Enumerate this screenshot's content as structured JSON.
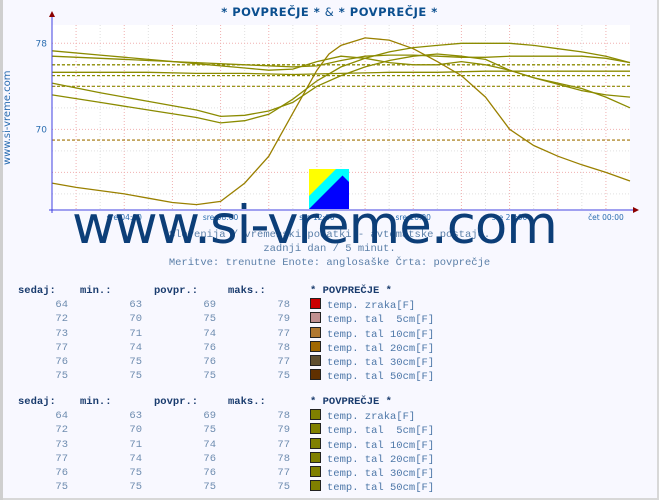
{
  "title": {
    "left": "* POVPREČJE *",
    "amp": "&",
    "right": "* POVPREČJE *"
  },
  "side_label": "www.si-vreme.com",
  "watermark": "www.si-vreme.com",
  "subtitle_lines": [
    "Slovenija / vremenski podatki - avtomatske postaje.",
    "zadnji dan / 5 minut.",
    "Meritve: trenutne  Enote: anglosaške  Črta: povprečje"
  ],
  "colors": {
    "line": "#8b8b00",
    "axis": "#4040e0",
    "grid": "#e8a0a0",
    "arrow": "#8b0000",
    "title": "#0b4f8f"
  },
  "chart_data": {
    "type": "line",
    "title": "* POVPREČJE * & * POVPREČJE *",
    "xlabel": "",
    "ylabel": "",
    "x_range_hours": [
      1,
      25
    ],
    "ylim": [
      62.5,
      79.7
    ],
    "yticks": [
      {
        "value": 70,
        "label": "70"
      },
      {
        "value": 78,
        "label": "78"
      }
    ],
    "xticks": [
      {
        "hour": 4,
        "label": "sre 04:00"
      },
      {
        "hour": 8,
        "label": "sre 08:00"
      },
      {
        "hour": 12,
        "label": "sre 12:00"
      },
      {
        "hour": 16,
        "label": "sre 16:00"
      },
      {
        "hour": 20,
        "label": "sre 20:00"
      },
      {
        "hour": 24,
        "label": "čet 00:00"
      }
    ],
    "grid": true,
    "series": [
      {
        "name": "temp. zraka[F]",
        "avg": 69,
        "points": [
          [
            1,
            65
          ],
          [
            2,
            64.6
          ],
          [
            3,
            64.3
          ],
          [
            4,
            64
          ],
          [
            5,
            63.6
          ],
          [
            6,
            63.2
          ],
          [
            7,
            63
          ],
          [
            8,
            63.3
          ],
          [
            9,
            65
          ],
          [
            10,
            67.5
          ],
          [
            10.5,
            69.5
          ],
          [
            11,
            71.5
          ],
          [
            11.5,
            73.5
          ],
          [
            12,
            75.5
          ],
          [
            12.5,
            77
          ],
          [
            13,
            77.8
          ],
          [
            14,
            78.5
          ],
          [
            15,
            78.3
          ],
          [
            16,
            77.5
          ],
          [
            17,
            76.3
          ],
          [
            18,
            75
          ],
          [
            19,
            73
          ],
          [
            20,
            70
          ],
          [
            21,
            68.5
          ],
          [
            22,
            67.5
          ],
          [
            23,
            66.7
          ],
          [
            24,
            66
          ],
          [
            25,
            65.2
          ]
        ]
      },
      {
        "name": "temp. tal  5cm[F]",
        "avg": 75,
        "points": [
          [
            1,
            73.2
          ],
          [
            3,
            72.5
          ],
          [
            5,
            71.8
          ],
          [
            7,
            71.1
          ],
          [
            8,
            70.6
          ],
          [
            9,
            70.8
          ],
          [
            10,
            71.4
          ],
          [
            11,
            72.8
          ],
          [
            12,
            74.5
          ],
          [
            13,
            75.8
          ],
          [
            14,
            76.6
          ],
          [
            15,
            77.2
          ],
          [
            16,
            77.6
          ],
          [
            17,
            77.8
          ],
          [
            18,
            78
          ],
          [
            19,
            78
          ],
          [
            20,
            78
          ],
          [
            21,
            77.8
          ],
          [
            22,
            77.5
          ],
          [
            23,
            77.2
          ],
          [
            24,
            76.8
          ],
          [
            25,
            76.2
          ]
        ]
      },
      {
        "name": "temp. tal 10cm[F]",
        "avg": 74,
        "points": [
          [
            1,
            74.3
          ],
          [
            3,
            73.4
          ],
          [
            5,
            72.6
          ],
          [
            7,
            71.8
          ],
          [
            8,
            71.2
          ],
          [
            9,
            71.3
          ],
          [
            10,
            71.7
          ],
          [
            11,
            72.5
          ],
          [
            12,
            74
          ],
          [
            13,
            75
          ],
          [
            14,
            75.8
          ],
          [
            15,
            76.4
          ],
          [
            16,
            76.8
          ],
          [
            17,
            77
          ],
          [
            18,
            76.8
          ],
          [
            19,
            76.5
          ],
          [
            20,
            75.5
          ],
          [
            21,
            74.8
          ],
          [
            22,
            74.2
          ],
          [
            23,
            73.6
          ],
          [
            24,
            73.2
          ],
          [
            25,
            73
          ]
        ]
      },
      {
        "name": "temp. tal 20cm[F]",
        "avg": 76,
        "points": [
          [
            1,
            77.3
          ],
          [
            3,
            76.9
          ],
          [
            5,
            76.5
          ],
          [
            7,
            76.1
          ],
          [
            9,
            75.7
          ],
          [
            10,
            75.5
          ],
          [
            11,
            75.6
          ],
          [
            12,
            76.3
          ],
          [
            13,
            76.8
          ],
          [
            14,
            76.6
          ],
          [
            15,
            76.2
          ],
          [
            16,
            76
          ],
          [
            17,
            76
          ],
          [
            18,
            76.3
          ],
          [
            19,
            76
          ],
          [
            20,
            75.5
          ],
          [
            21,
            74.8
          ],
          [
            22,
            74.3
          ],
          [
            23,
            73.8
          ],
          [
            24,
            73
          ],
          [
            25,
            72
          ]
        ]
      },
      {
        "name": "temp. tal 30cm[F]",
        "avg": 76,
        "points": [
          [
            1,
            76.8
          ],
          [
            3,
            76.6
          ],
          [
            5,
            76.4
          ],
          [
            7,
            76.2
          ],
          [
            9,
            76
          ],
          [
            11,
            75.8
          ],
          [
            12,
            75.9
          ],
          [
            13,
            76.4
          ],
          [
            14,
            76.8
          ],
          [
            15,
            76.9
          ],
          [
            16,
            76.9
          ],
          [
            17,
            76.8
          ],
          [
            18,
            76.7
          ],
          [
            19,
            76.7
          ],
          [
            20,
            76.8
          ],
          [
            21,
            76.8
          ],
          [
            22,
            76.8
          ],
          [
            23,
            76.8
          ],
          [
            24,
            76.6
          ],
          [
            25,
            76.2
          ]
        ]
      },
      {
        "name": "temp. tal 50cm[F]",
        "avg": 75,
        "points": [
          [
            1,
            75.3
          ],
          [
            3,
            75.3
          ],
          [
            5,
            75.3
          ],
          [
            7,
            75.2
          ],
          [
            9,
            75.2
          ],
          [
            11,
            75.1
          ],
          [
            13,
            75.2
          ],
          [
            15,
            75.3
          ],
          [
            17,
            75.3
          ],
          [
            19,
            75.4
          ],
          [
            21,
            75.4
          ],
          [
            23,
            75.4
          ],
          [
            25,
            75.4
          ]
        ]
      }
    ]
  },
  "tables": [
    {
      "headers": [
        "sedaj:",
        "min.:",
        "povpr.:",
        "maks.:",
        "* POVPREČJE *"
      ],
      "rows": [
        {
          "now": "64",
          "min": "63",
          "avg": "69",
          "max": "78",
          "label": "temp. zraka[F]",
          "color": "#cc0000"
        },
        {
          "now": "72",
          "min": "70",
          "avg": "75",
          "max": "79",
          "label": "temp. tal  5cm[F]",
          "color": "#c09090"
        },
        {
          "now": "73",
          "min": "71",
          "avg": "74",
          "max": "77",
          "label": "temp. tal 10cm[F]",
          "color": "#b07830"
        },
        {
          "now": "77",
          "min": "74",
          "avg": "76",
          "max": "78",
          "label": "temp. tal 20cm[F]",
          "color": "#a06800"
        },
        {
          "now": "76",
          "min": "75",
          "avg": "76",
          "max": "77",
          "label": "temp. tal 30cm[F]",
          "color": "#605030"
        },
        {
          "now": "75",
          "min": "75",
          "avg": "75",
          "max": "75",
          "label": "temp. tal 50cm[F]",
          "color": "#603000"
        }
      ]
    },
    {
      "headers": [
        "sedaj:",
        "min.:",
        "povpr.:",
        "maks.:",
        "* POVPREČJE *"
      ],
      "rows": [
        {
          "now": "64",
          "min": "63",
          "avg": "69",
          "max": "78",
          "label": "temp. zraka[F]",
          "color": "#808000"
        },
        {
          "now": "72",
          "min": "70",
          "avg": "75",
          "max": "79",
          "label": "temp. tal  5cm[F]",
          "color": "#808000"
        },
        {
          "now": "73",
          "min": "71",
          "avg": "74",
          "max": "77",
          "label": "temp. tal 10cm[F]",
          "color": "#808000"
        },
        {
          "now": "77",
          "min": "74",
          "avg": "76",
          "max": "78",
          "label": "temp. tal 20cm[F]",
          "color": "#808000"
        },
        {
          "now": "76",
          "min": "75",
          "avg": "76",
          "max": "77",
          "label": "temp. tal 30cm[F]",
          "color": "#808000"
        },
        {
          "now": "75",
          "min": "75",
          "avg": "75",
          "max": "75",
          "label": "temp. tal 50cm[F]",
          "color": "#808000"
        }
      ]
    }
  ]
}
